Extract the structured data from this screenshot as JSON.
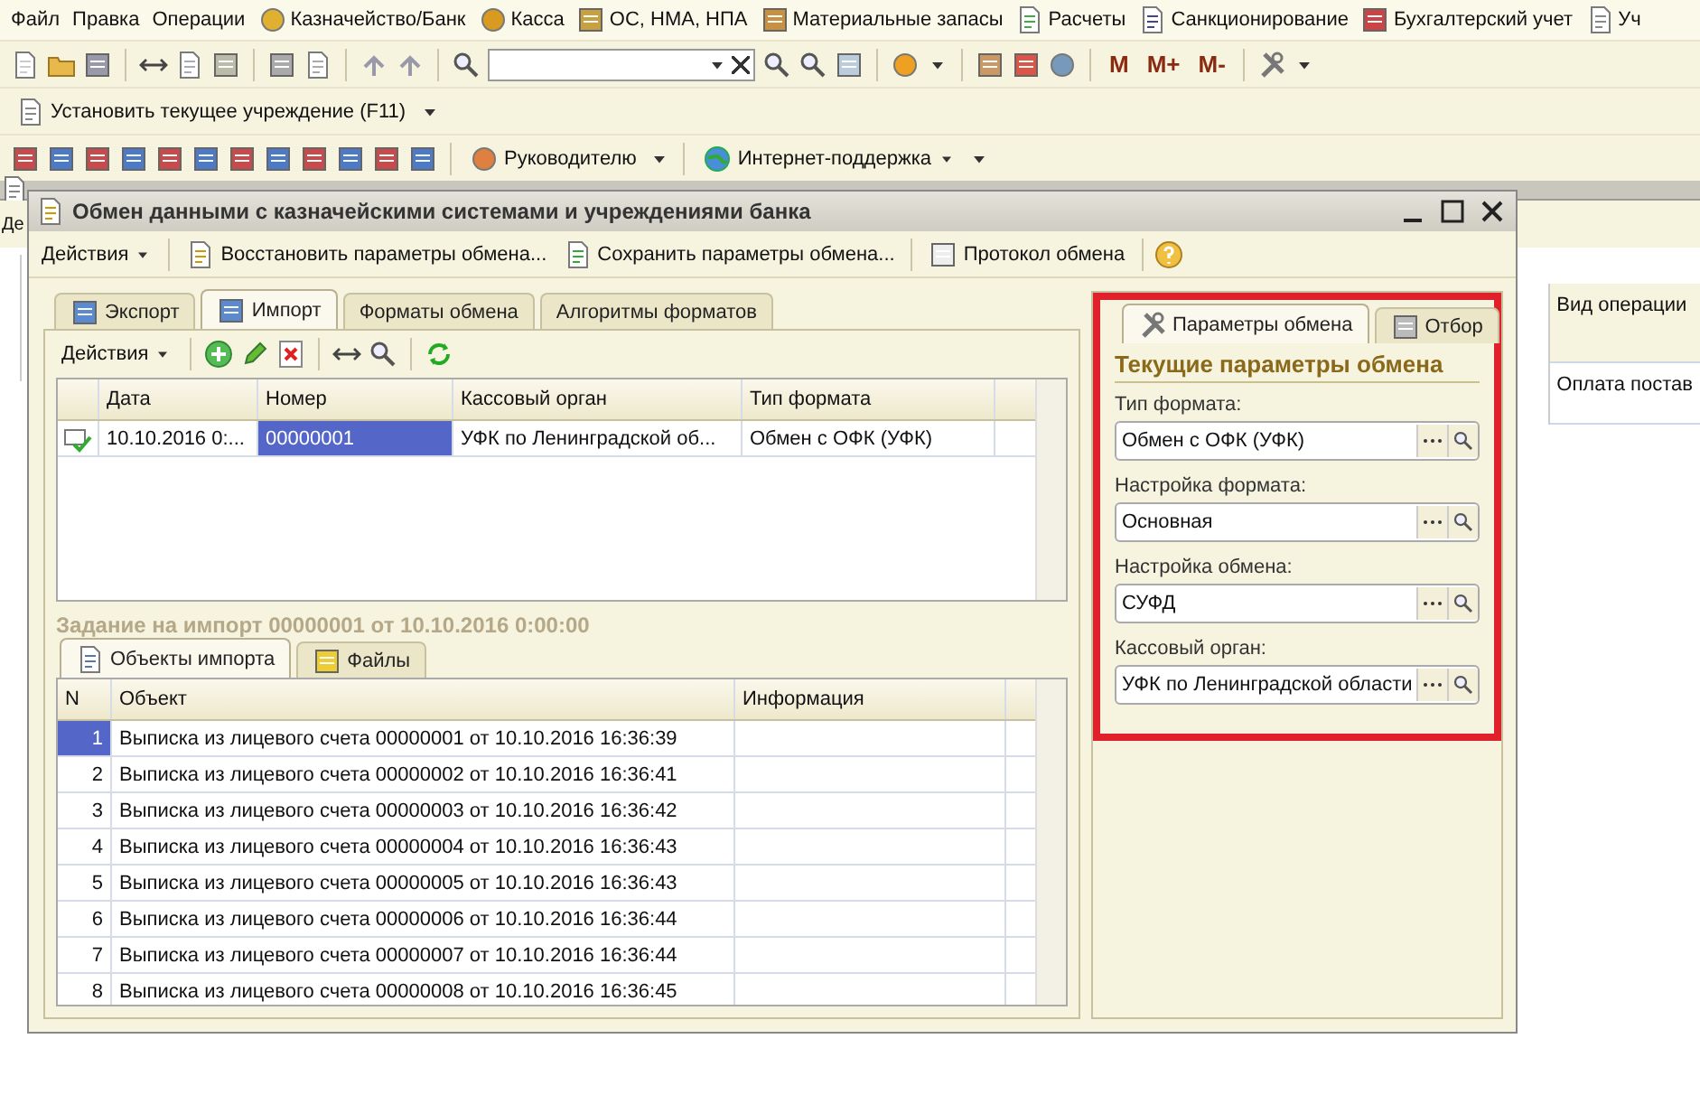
{
  "menu": [
    "Файл",
    "Правка",
    "Операции",
    "Казначейство/Банк",
    "Касса",
    "ОС, НМА, НПА",
    "Материальные запасы",
    "Расчеты",
    "Санкционирование",
    "Бухгалтерский учет",
    "Уч"
  ],
  "toolbar": {
    "memory_buttons": [
      "M",
      "M+",
      "M-"
    ]
  },
  "institution_button": "Установить текущее учреждение (F11)",
  "reports_toolbar": {
    "manager_button": "Руководителю",
    "support_button": "Интернет-поддержка"
  },
  "background_window": {
    "toolbar_text": "Де",
    "column": "Вид операции",
    "cell": "Оплата постав"
  },
  "dialog": {
    "title": "Обмен данными с казначейскими системами и учреждениями банка",
    "toolbar": {
      "actions": "Действия",
      "restore": "Восстановить параметры обмена...",
      "save": "Сохранить параметры обмена...",
      "log": "Протокол обмена"
    },
    "tabs": [
      {
        "label": "Экспорт",
        "selected": false
      },
      {
        "label": "Импорт",
        "selected": true
      },
      {
        "label": "Форматы обмена",
        "selected": false
      },
      {
        "label": "Алгоритмы форматов",
        "selected": false
      }
    ],
    "actions": "Действия",
    "tasks": {
      "columns": [
        "Дата",
        "Номер",
        "Кассовый орган",
        "Тип формата"
      ],
      "rows": [
        {
          "cells": [
            "10.10.2016 0:...",
            "00000001",
            "УФК по Ленинградской об...",
            "Обмен с ОФК (УФК)"
          ],
          "selected": true
        }
      ]
    },
    "task_title": "Задание на импорт 00000001 от 10.10.2016 0:00:00",
    "subtabs": [
      {
        "label": "Объекты импорта",
        "selected": true
      },
      {
        "label": "Файлы",
        "selected": false
      }
    ],
    "objects": {
      "columns": [
        "N",
        "Объект",
        "Информация"
      ],
      "rows": [
        {
          "n": "1",
          "object": "Выписка из лицевого счета 00000001 от 10.10.2016 16:36:39",
          "selected": true
        },
        {
          "n": "2",
          "object": "Выписка из лицевого счета 00000002 от 10.10.2016 16:36:41",
          "selected": false
        },
        {
          "n": "3",
          "object": "Выписка из лицевого счета 00000003 от 10.10.2016 16:36:42",
          "selected": false
        },
        {
          "n": "4",
          "object": "Выписка из лицевого счета 00000004 от 10.10.2016 16:36:43",
          "selected": false
        },
        {
          "n": "5",
          "object": "Выписка из лицевого счета 00000005 от 10.10.2016 16:36:43",
          "selected": false
        },
        {
          "n": "6",
          "object": "Выписка из лицевого счета 00000006 от 10.10.2016 16:36:44",
          "selected": false
        },
        {
          "n": "7",
          "object": "Выписка из лицевого счета 00000007 от 10.10.2016 16:36:44",
          "selected": false
        },
        {
          "n": "8",
          "object": "Выписка из лицевого счета 00000008 от 10.10.2016 16:36:45",
          "selected": false
        }
      ]
    }
  },
  "params": {
    "tabs": [
      {
        "label": "Параметры обмена",
        "selected": true
      },
      {
        "label": "Отбор",
        "selected": false
      }
    ],
    "heading": "Текущие параметры обмена",
    "fields": [
      {
        "label": "Тип формата:",
        "value": "Обмен с ОФК (УФК)"
      },
      {
        "label": "Настройка формата:",
        "value": "Основная"
      },
      {
        "label": "Настройка обмена:",
        "value": "СУФД"
      },
      {
        "label": "Кассовый орган:",
        "value": "УФК по Ленинградской области"
      }
    ]
  }
}
